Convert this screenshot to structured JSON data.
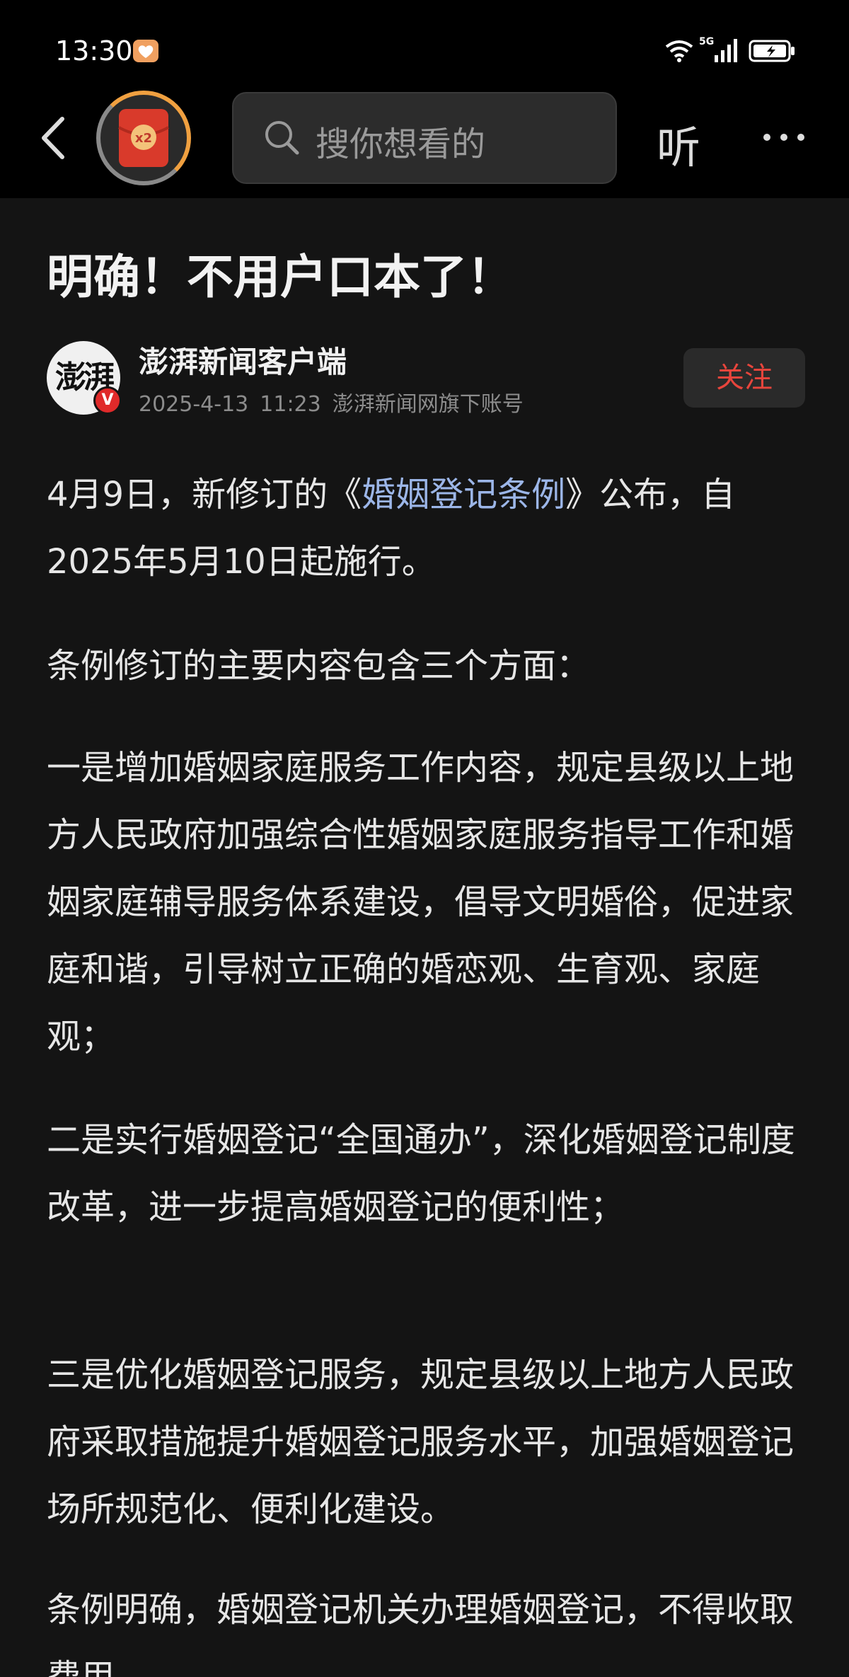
{
  "status": {
    "time": "13:30",
    "network": "5G"
  },
  "nav": {
    "search_placeholder": "搜你想看的",
    "listen_label": "听",
    "redpacket_label": "x2"
  },
  "article": {
    "title": "明确！不用户口本了！",
    "author": {
      "name": "澎湃新闻客户端",
      "avatar_text": "澎湃",
      "verified": "V",
      "date": "2025-4-13",
      "time": "11:23",
      "desc": "澎湃新闻网旗下账号",
      "follow_label": "关注"
    },
    "p1_pre": "4月9日，新修订的《",
    "p1_link": "婚姻登记条例",
    "p1_post": "》公布，自2025年5月10日起施行。",
    "p2": "条例修订的主要内容包含三个方面：",
    "p3": "一是增加婚姻家庭服务工作内容，规定县级以上地方人民政府加强综合性婚姻家庭服务指导工作和婚姻家庭辅导服务体系建设，倡导文明婚俗，促进家庭和谐，引导树立正确的婚恋观、生育观、家庭观；",
    "p4": "二是实行婚姻登记“全国通办”，深化婚姻登记制度改革，进一步提高婚姻登记的便利性；",
    "p5": "三是优化婚姻登记服务，规定县级以上地方人民政府采取措施提升婚姻登记服务水平，加强婚姻登记场所规范化、便利化建设。",
    "p6": "条例明确，婚姻登记机关办理婚姻登记，不得收取费用。"
  }
}
